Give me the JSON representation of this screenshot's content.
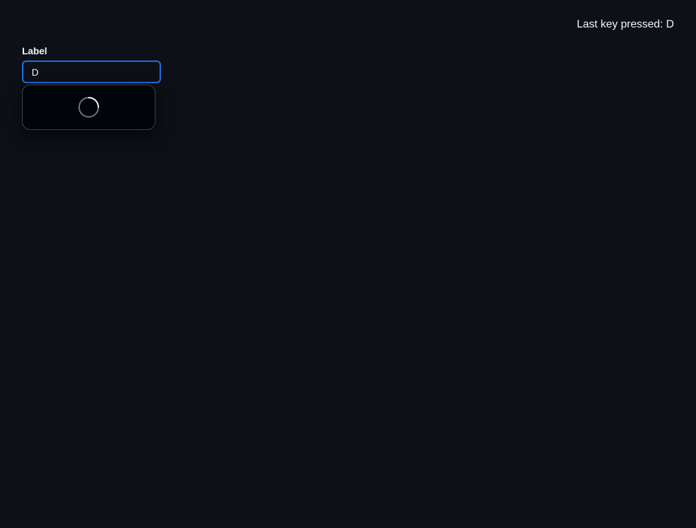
{
  "status": {
    "last_key_text": "Last key pressed: D"
  },
  "field": {
    "label": "Label",
    "value": "D"
  },
  "dropdown": {
    "loading_icon": "spinner-icon"
  },
  "colors": {
    "background": "#0d1117",
    "focus_border": "#1f6feb",
    "overlay_background": "#010409",
    "overlay_border": "#3d444d",
    "text": "#f0f6fc"
  }
}
